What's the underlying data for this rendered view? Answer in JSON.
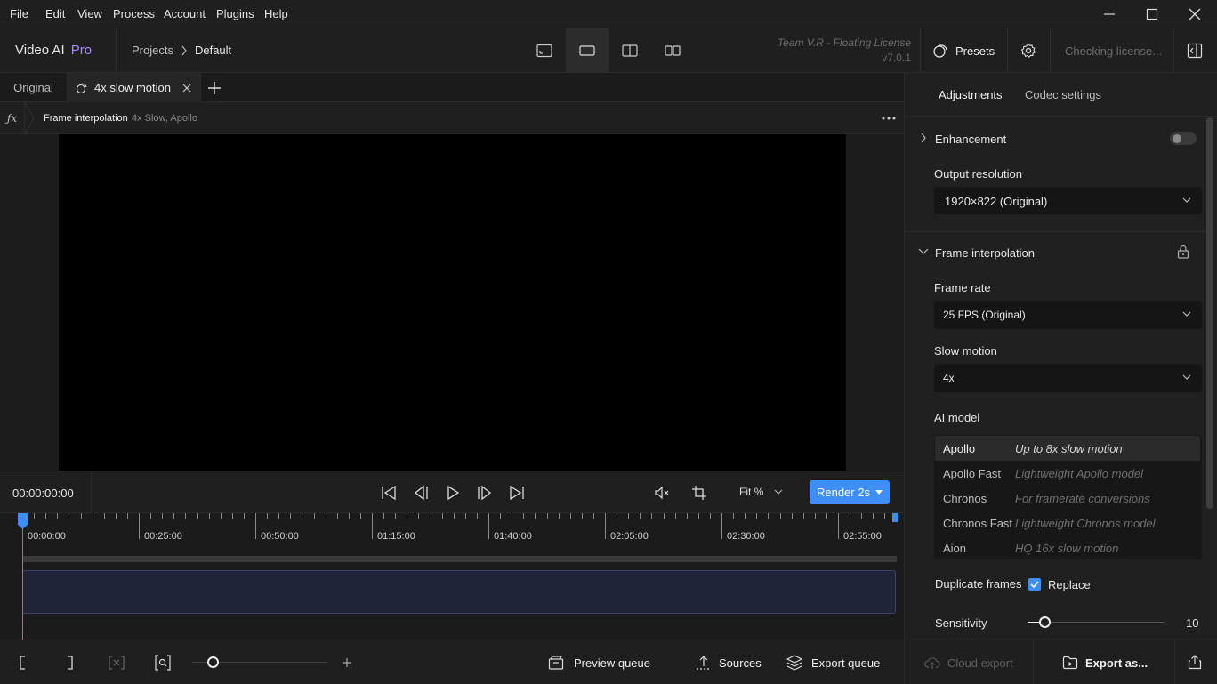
{
  "menu": {
    "file": "File",
    "edit": "Edit",
    "view": "View",
    "process": "Process",
    "account": "Account",
    "plugins": "Plugins",
    "help": "Help"
  },
  "header": {
    "app_name": "Video AI",
    "app_badge": "Pro",
    "breadcrumb_projects": "Projects",
    "breadcrumb_current": "Default",
    "license_team": "Team V.R - Floating License",
    "version": "v7.0.1",
    "presets_label": "Presets",
    "license_status": "Checking license..."
  },
  "tabs": {
    "original": "Original",
    "active": "4x slow motion"
  },
  "fx": {
    "filter_name": "Frame interpolation",
    "filter_detail": "4x Slow, Apollo"
  },
  "transport": {
    "timecode": "00:00:00:00",
    "fit": "Fit %",
    "render": "Render 2s"
  },
  "timeline": {
    "ticks": [
      "00:00:00",
      "00:25:00",
      "00:50:00",
      "01:15:00",
      "01:40:00",
      "02:05:00",
      "02:30:00",
      "02:55:00"
    ]
  },
  "bottom": {
    "preview_queue": "Preview queue",
    "sources": "Sources",
    "export_queue": "Export queue",
    "zoom_level": 0.0
  },
  "panel": {
    "tab_adjustments": "Adjustments",
    "tab_codec": "Codec settings",
    "enhancement": "Enhancement",
    "enhancement_on": false,
    "output_resolution_label": "Output resolution",
    "output_resolution": "1920×822 (Original)",
    "frame_interpolation": "Frame interpolation",
    "frame_rate_label": "Frame rate",
    "frame_rate": "25 FPS (Original)",
    "slow_motion_label": "Slow motion",
    "slow_motion": "4x",
    "ai_model_label": "AI model",
    "models": [
      {
        "name": "Apollo",
        "desc": "Up to 8x slow motion"
      },
      {
        "name": "Apollo Fast",
        "desc": "Lightweight Apollo model"
      },
      {
        "name": "Chronos",
        "desc": "For framerate conversions"
      },
      {
        "name": "Chronos Fast",
        "desc": "Lightweight Chronos model"
      },
      {
        "name": "Aion",
        "desc": "HQ 16x slow motion"
      }
    ],
    "duplicate_frames_label": "Duplicate frames",
    "replace_label": "Replace",
    "replace_checked": true,
    "sensitivity_label": "Sensitivity",
    "sensitivity_value": "10"
  },
  "footer": {
    "cloud_export": "Cloud export",
    "export_as": "Export as..."
  },
  "colors": {
    "accent": "#3d8ef7",
    "pro": "#a78bfa",
    "selected_row": "#2b2b2b"
  }
}
